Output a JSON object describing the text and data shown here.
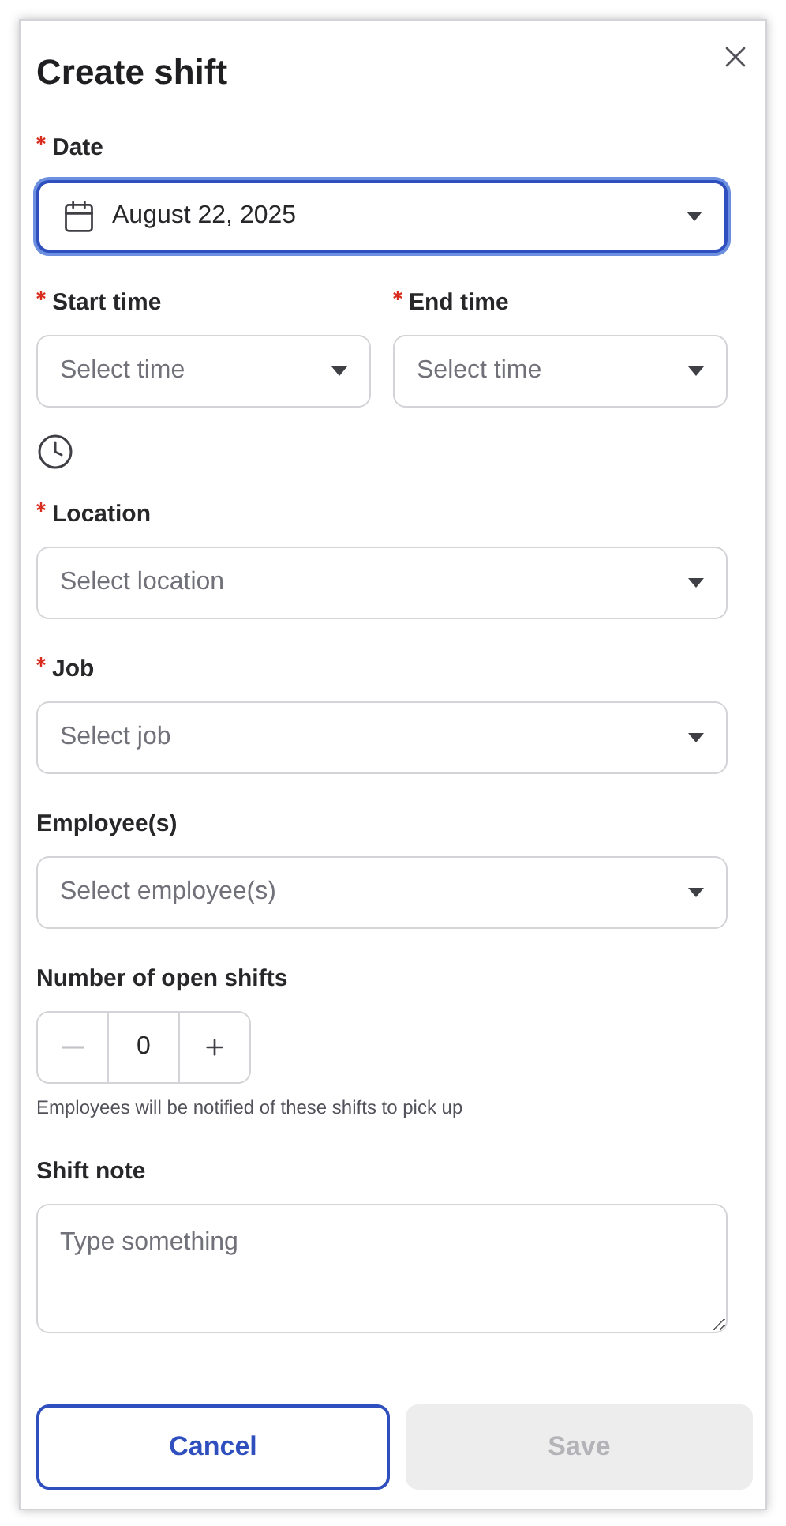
{
  "title": "Create shift",
  "fields": [
    {
      "kind": "date",
      "label": "Date",
      "required": true,
      "value": "August 22, 2025",
      "focused": true
    },
    {
      "kind": "time_pair",
      "items": [
        {
          "label": "Start time",
          "required": true,
          "placeholder": "Select time"
        },
        {
          "label": "End time",
          "required": true,
          "placeholder": "Select time"
        }
      ]
    },
    {
      "kind": "select",
      "label": "Location",
      "required": true,
      "placeholder": "Select location",
      "focused": false
    },
    {
      "kind": "select",
      "label": "Job",
      "required": true,
      "placeholder": "Select job",
      "focused": false
    },
    {
      "kind": "select",
      "label": "Employee(s)",
      "required": false,
      "placeholder": "Select employee(s)",
      "focused": false
    },
    {
      "kind": "stepper",
      "label": "Number of open shifts",
      "required": false,
      "value": "0",
      "decrement_disabled": true,
      "help": "Employees will be notified of these shifts to pick up"
    },
    {
      "kind": "textarea",
      "label": "Shift note",
      "required": false,
      "placeholder": "Type something"
    }
  ],
  "buttons": [
    {
      "label": "Cancel",
      "kind": "secondary",
      "disabled": false
    },
    {
      "label": "Save",
      "kind": "primary",
      "disabled": true
    }
  ]
}
